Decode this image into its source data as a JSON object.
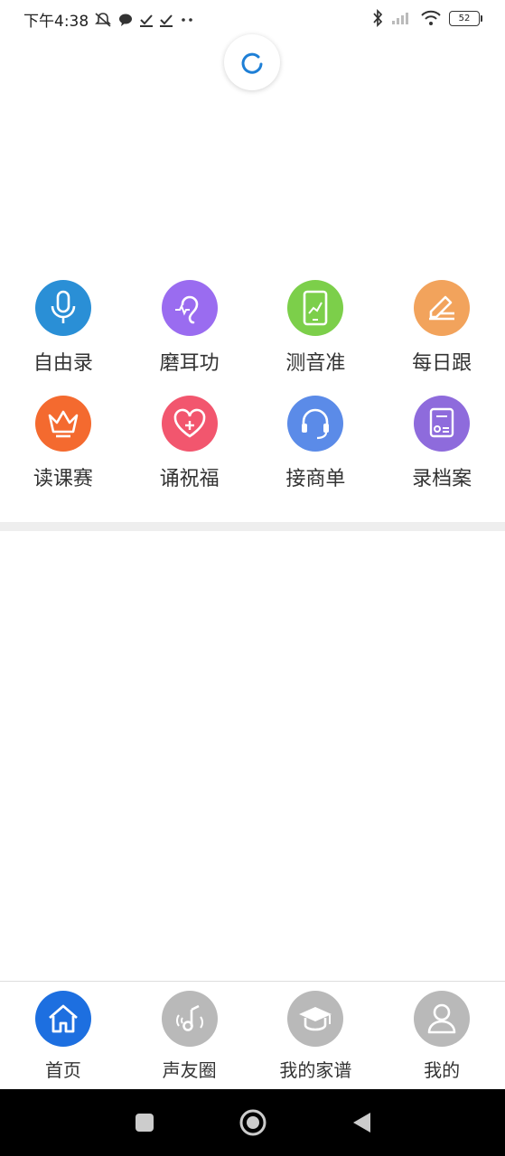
{
  "status_bar": {
    "time": "下午4:38",
    "battery": "52"
  },
  "grid": [
    [
      {
        "label": "自由录",
        "icon": "microphone-icon",
        "color": "#2a8fd6"
      },
      {
        "label": "磨耳功",
        "icon": "ear-icon",
        "color": "#9a6cf0"
      },
      {
        "label": "测音准",
        "icon": "tablet-chart-icon",
        "color": "#7ccf4a"
      },
      {
        "label": "每日跟",
        "icon": "pencil-icon",
        "color": "#f2a35c"
      }
    ],
    [
      {
        "label": "读课赛",
        "icon": "crown-icon",
        "color": "#f46a2f"
      },
      {
        "label": "诵祝福",
        "icon": "heart-plus-icon",
        "color": "#f2566e"
      },
      {
        "label": "接商单",
        "icon": "headset-icon",
        "color": "#5b8be8"
      },
      {
        "label": "录档案",
        "icon": "document-icon",
        "color": "#8e6bdc"
      }
    ]
  ],
  "tabs": [
    {
      "label": "首页",
      "icon": "home-icon",
      "color": "#1d6fe0",
      "active": true
    },
    {
      "label": "声友圈",
      "icon": "music-note-icon",
      "color": "#b9b9b9",
      "active": false
    },
    {
      "label": "我的家谱",
      "icon": "graduation-cap-icon",
      "color": "#b9b9b9",
      "active": false
    },
    {
      "label": "我的",
      "icon": "user-icon",
      "color": "#b9b9b9",
      "active": false
    }
  ]
}
